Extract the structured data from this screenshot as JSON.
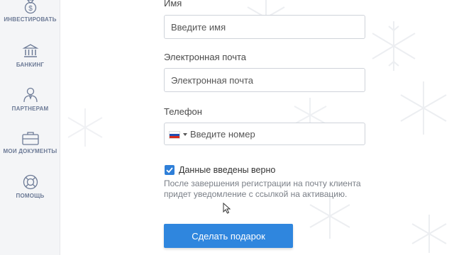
{
  "sidebar": {
    "items": [
      {
        "label": "ИНВЕСТИРОВАТЬ",
        "icon": "money-bag-icon"
      },
      {
        "label": "БАНКИНГ",
        "icon": "bank-icon"
      },
      {
        "label": "ПАРТНЕРАМ",
        "icon": "partner-icon"
      },
      {
        "label": "МОИ ДОКУМЕНТЫ",
        "icon": "briefcase-icon"
      },
      {
        "label": "ПОМОЩЬ",
        "icon": "lifebuoy-icon"
      }
    ]
  },
  "form": {
    "name": {
      "label": "Имя",
      "placeholder": "Введите имя"
    },
    "email": {
      "label": "Электронная почта",
      "placeholder": "Электронная почта"
    },
    "phone": {
      "label": "Телефон",
      "placeholder": "Введите номер",
      "country_flag": "russia-flag-icon"
    },
    "confirm": {
      "label": "Данные введены верно",
      "checked": true
    },
    "hint": "После завершения регистрации на почту клиента придет уведомление с ссылкой на активацию.",
    "submit_label": "Сделать подарок"
  },
  "colors": {
    "accent": "#2f86de",
    "sidebar_bg": "#f4f5f7",
    "sidebar_text": "#6c7a96"
  }
}
